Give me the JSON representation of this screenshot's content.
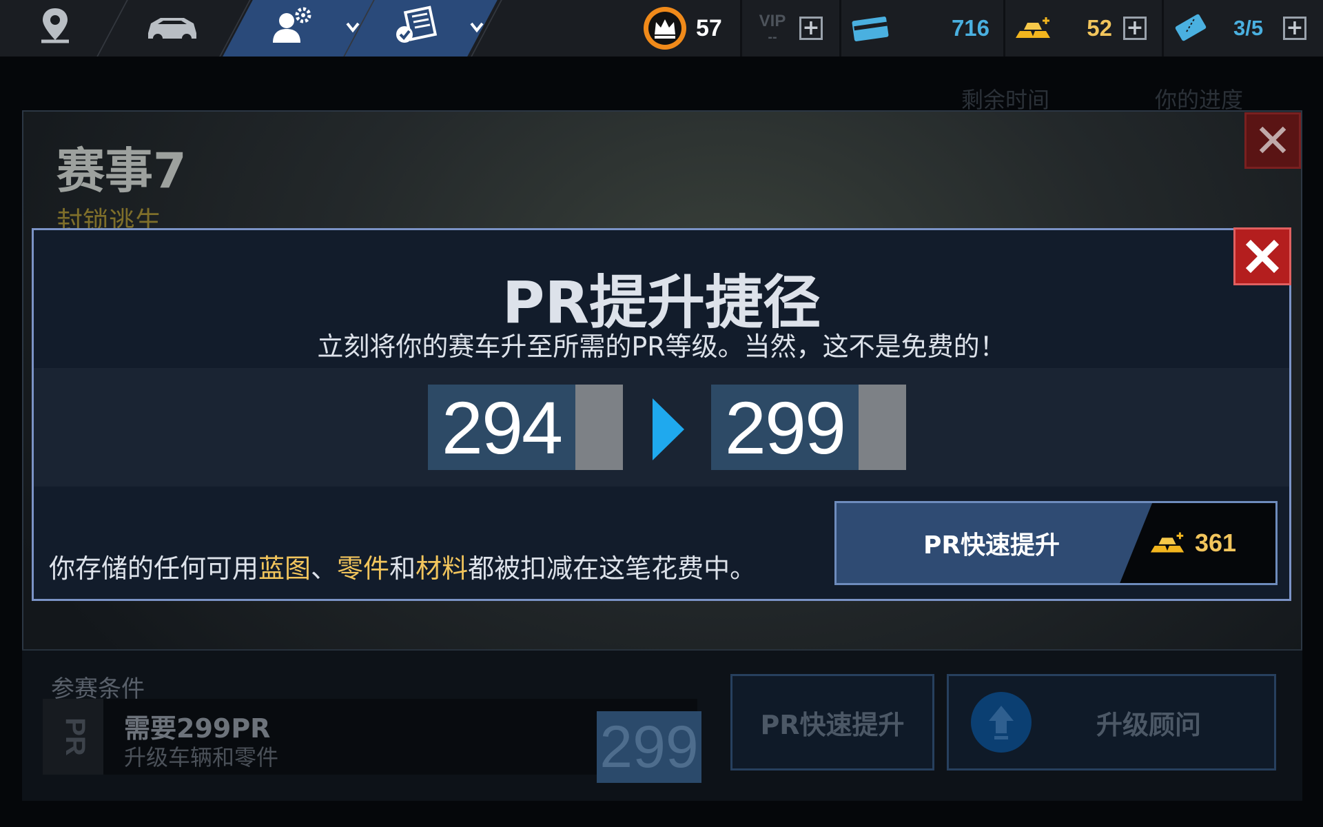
{
  "topbar": {
    "nav": [
      {
        "icon": "location-pin-icon"
      },
      {
        "icon": "car-icon"
      },
      {
        "icon": "profile-settings-icon",
        "active": true
      },
      {
        "icon": "checklist-icon",
        "active": true
      }
    ],
    "level": "57",
    "vip_label": "VIP",
    "vip_value": "--",
    "cash": "716",
    "gold": "52",
    "tickets": "3/5",
    "plus": "+"
  },
  "background_event": {
    "title": "赛事7",
    "subtitle": "封锁逃生",
    "header_time": "剩余时间",
    "header_progress": "你的进度",
    "close": "✕",
    "entry_label": "参赛条件",
    "entry_requirement": "需要299PR",
    "entry_hint": "升级车辆和零件",
    "entry_value": "299",
    "boost_button": "PR快速提升",
    "advisor_button": "升级顾问"
  },
  "modal": {
    "title": "PR提升捷径",
    "subtitle": "立刻将你的赛车升至所需的PR等级。当然，这不是免费的！",
    "from_pr": "294",
    "to_pr": "299",
    "pr_tag": "PR",
    "footnote_parts": [
      "你存储的任何可用",
      "蓝图",
      "、",
      "零件",
      "和",
      "材料",
      "都被扣减在这笔花费中。"
    ],
    "boost_label": "PR快速提升",
    "boost_cost": "361"
  },
  "colors": {
    "accent_blue": "#2a4a7a",
    "arrow_blue": "#1fa9ee",
    "gold": "#f2c55c",
    "close_red": "#b41e1e"
  }
}
